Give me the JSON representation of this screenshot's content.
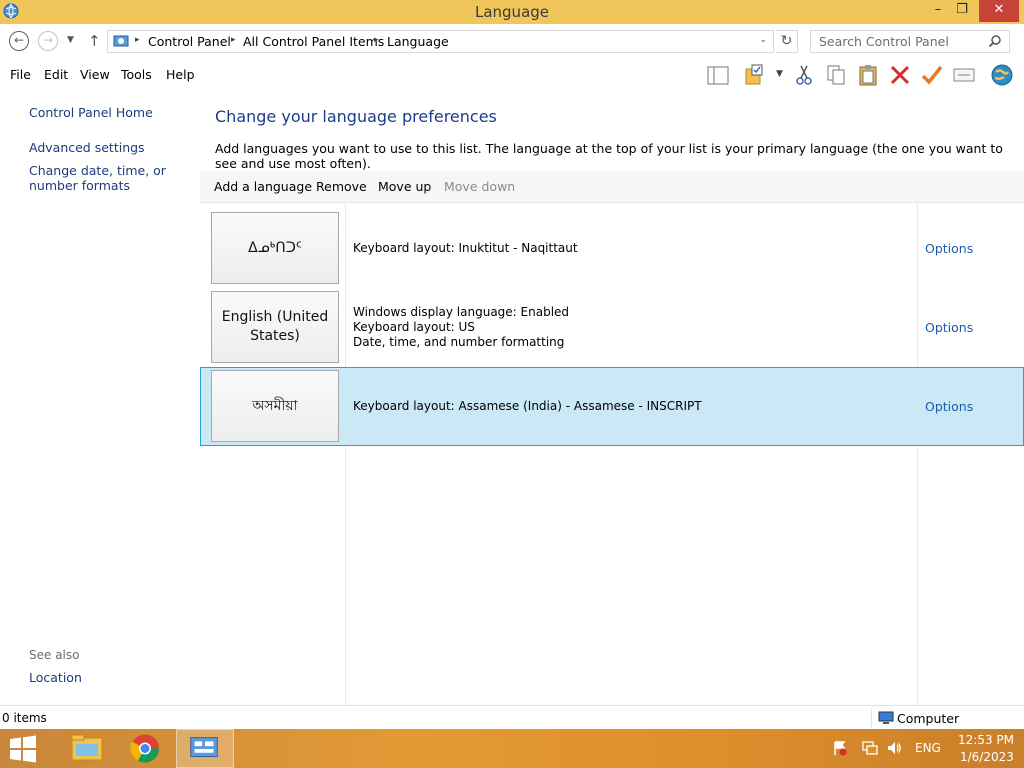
{
  "window": {
    "title": "Language",
    "minimize": "–",
    "maximize": "❐",
    "close": "✕"
  },
  "address": {
    "crumbs": [
      "Control Panel",
      "All Control Panel Items",
      "Language"
    ],
    "search_placeholder": "Search Control Panel"
  },
  "menu": [
    "File",
    "Edit",
    "View",
    "Tools",
    "Help"
  ],
  "left_pane": {
    "links": [
      "Control Panel Home",
      "Advanced settings",
      "Change date, time, or number formats"
    ],
    "see_also": "See also",
    "see_also_links": [
      "Location"
    ]
  },
  "main": {
    "heading": "Change your language preferences",
    "description": "Add languages you want to use to this list. The language at the top of your list is your primary language (the one you want to see and use most often).",
    "commands": {
      "add": "Add a language",
      "remove": "Remove",
      "move_up": "Move up",
      "move_down": "Move down"
    },
    "languages": [
      {
        "tile": "ᐃᓄᒃᑎᑐᑦ",
        "info": [
          "Keyboard layout: Inuktitut - Naqittaut"
        ],
        "options": "Options",
        "selected": false
      },
      {
        "tile": "English (United States)",
        "info": [
          "Windows display language: Enabled",
          "Keyboard layout: US",
          "Date, time, and number formatting"
        ],
        "options": "Options",
        "selected": false
      },
      {
        "tile": "অসমীয়া",
        "info": [
          "Keyboard layout: Assamese (India) - Assamese - INSCRIPT"
        ],
        "options": "Options",
        "selected": true
      }
    ]
  },
  "status": {
    "items": "0 items",
    "location": "Computer"
  },
  "taskbar": {
    "lang": "ENG",
    "time": "12:53 PM",
    "date": "1/6/2023"
  },
  "colors": {
    "titlebar": "#f0c55a",
    "link": "#1d3c7c",
    "heading": "#1e3c8a",
    "selected_bg": "#cbe8f6",
    "selected_border": "#26a0da",
    "taskbar": "#e39a36"
  }
}
